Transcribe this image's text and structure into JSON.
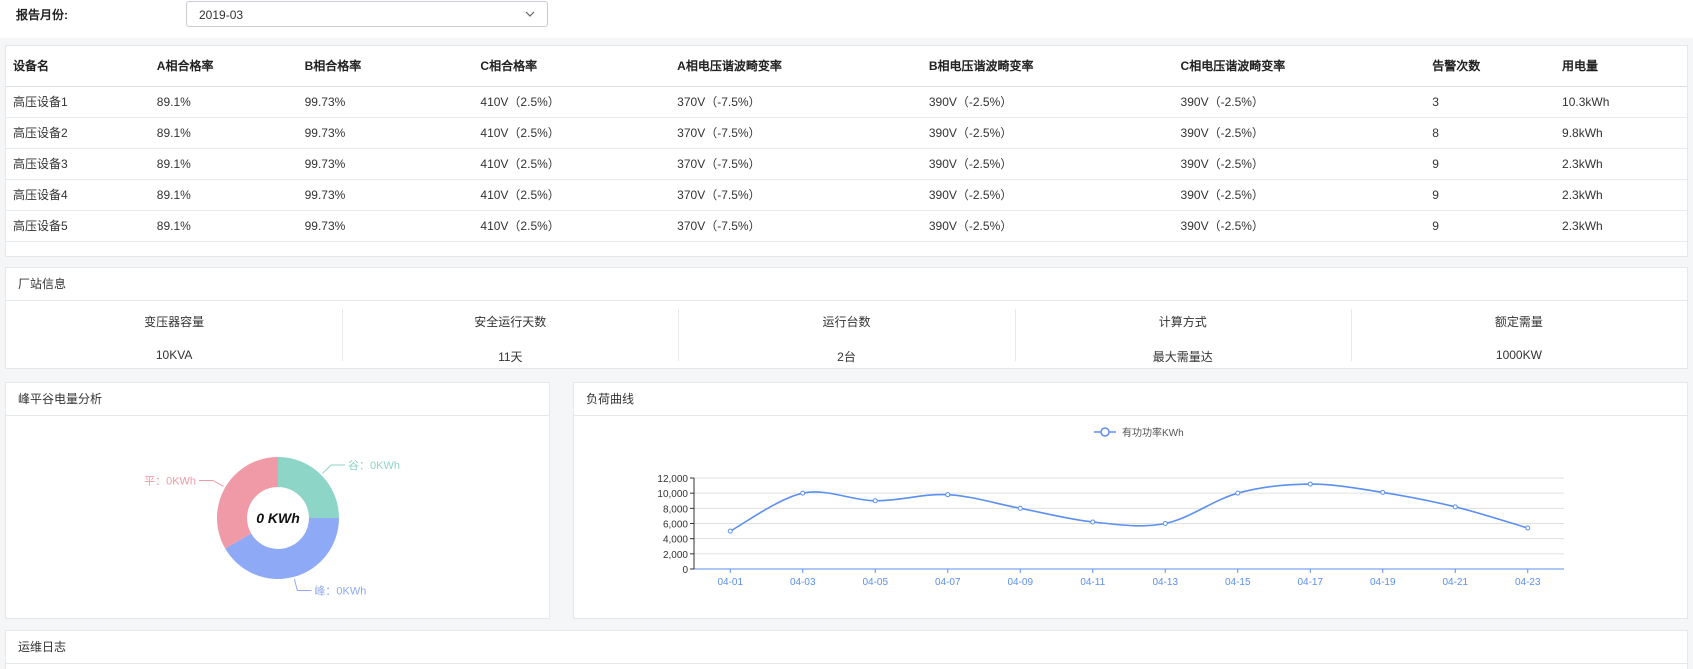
{
  "filter": {
    "label": "报告月份:",
    "month_value": "2019-03"
  },
  "table": {
    "headers": [
      "设备名",
      "A相合格率",
      "B相合格率",
      "C相合格率",
      "A相电压谐波畸变率",
      "B相电压谐波畸变率",
      "C相电压谐波畸变率",
      "告警次数",
      "用电量"
    ],
    "rows": [
      [
        "高压设备1",
        "89.1%",
        "99.73%",
        "410V（2.5%）",
        "370V（-7.5%）",
        "390V（-2.5%）",
        "390V（-2.5%）",
        "3",
        "10.3kWh"
      ],
      [
        "高压设备2",
        "89.1%",
        "99.73%",
        "410V（2.5%）",
        "370V（-7.5%）",
        "390V（-2.5%）",
        "390V（-2.5%）",
        "8",
        "9.8kWh"
      ],
      [
        "高压设备3",
        "89.1%",
        "99.73%",
        "410V（2.5%）",
        "370V（-7.5%）",
        "390V（-2.5%）",
        "390V（-2.5%）",
        "9",
        "2.3kWh"
      ],
      [
        "高压设备4",
        "89.1%",
        "99.73%",
        "410V（2.5%）",
        "370V（-7.5%）",
        "390V（-2.5%）",
        "390V（-2.5%）",
        "9",
        "2.3kWh"
      ],
      [
        "高压设备5",
        "89.1%",
        "99.73%",
        "410V（2.5%）",
        "370V（-7.5%）",
        "390V（-2.5%）",
        "390V（-2.5%）",
        "9",
        "2.3kWh"
      ]
    ]
  },
  "station": {
    "title": "厂站信息",
    "items": [
      {
        "label": "变压器容量",
        "value": "10KVA"
      },
      {
        "label": "安全运行天数",
        "value": "11天"
      },
      {
        "label": "运行台数",
        "value": "2台"
      },
      {
        "label": "计算方式",
        "value": "最大需量达"
      },
      {
        "label": "额定需量",
        "value": "1000KW"
      }
    ]
  },
  "donut": {
    "title": "峰平谷电量分析",
    "center_text": "0 KWh",
    "segments": [
      {
        "label": "谷：0KWh",
        "fraction": 0.25,
        "color": "#8dd5c6"
      },
      {
        "label": "峰：0KWh",
        "fraction": 0.4167,
        "color": "#8eaaf7"
      },
      {
        "label": "平：0KWh",
        "fraction": 0.3333,
        "color": "#ef9aa6"
      }
    ]
  },
  "line": {
    "title": "负荷曲线",
    "legend": "有功功率KWh",
    "color": "#5b8ff0"
  },
  "chart_data": {
    "type": "line",
    "x": [
      "04-01",
      "04-03",
      "04-05",
      "04-07",
      "04-09",
      "04-11",
      "04-13",
      "04-15",
      "04-17",
      "04-19",
      "04-21",
      "04-23"
    ],
    "series": [
      {
        "name": "有功功率KWh",
        "values": [
          5000,
          10000,
          9000,
          9800,
          8000,
          6200,
          6000,
          10000,
          11200,
          10100,
          8200,
          5400
        ]
      }
    ],
    "ylim": [
      0,
      12000
    ],
    "yticks": [
      "0",
      "2,000",
      "4,000",
      "6,000",
      "8,000",
      "10,000",
      "12,000"
    ],
    "grid": true,
    "legend": "top-center"
  },
  "log": {
    "title": "运维日志"
  }
}
